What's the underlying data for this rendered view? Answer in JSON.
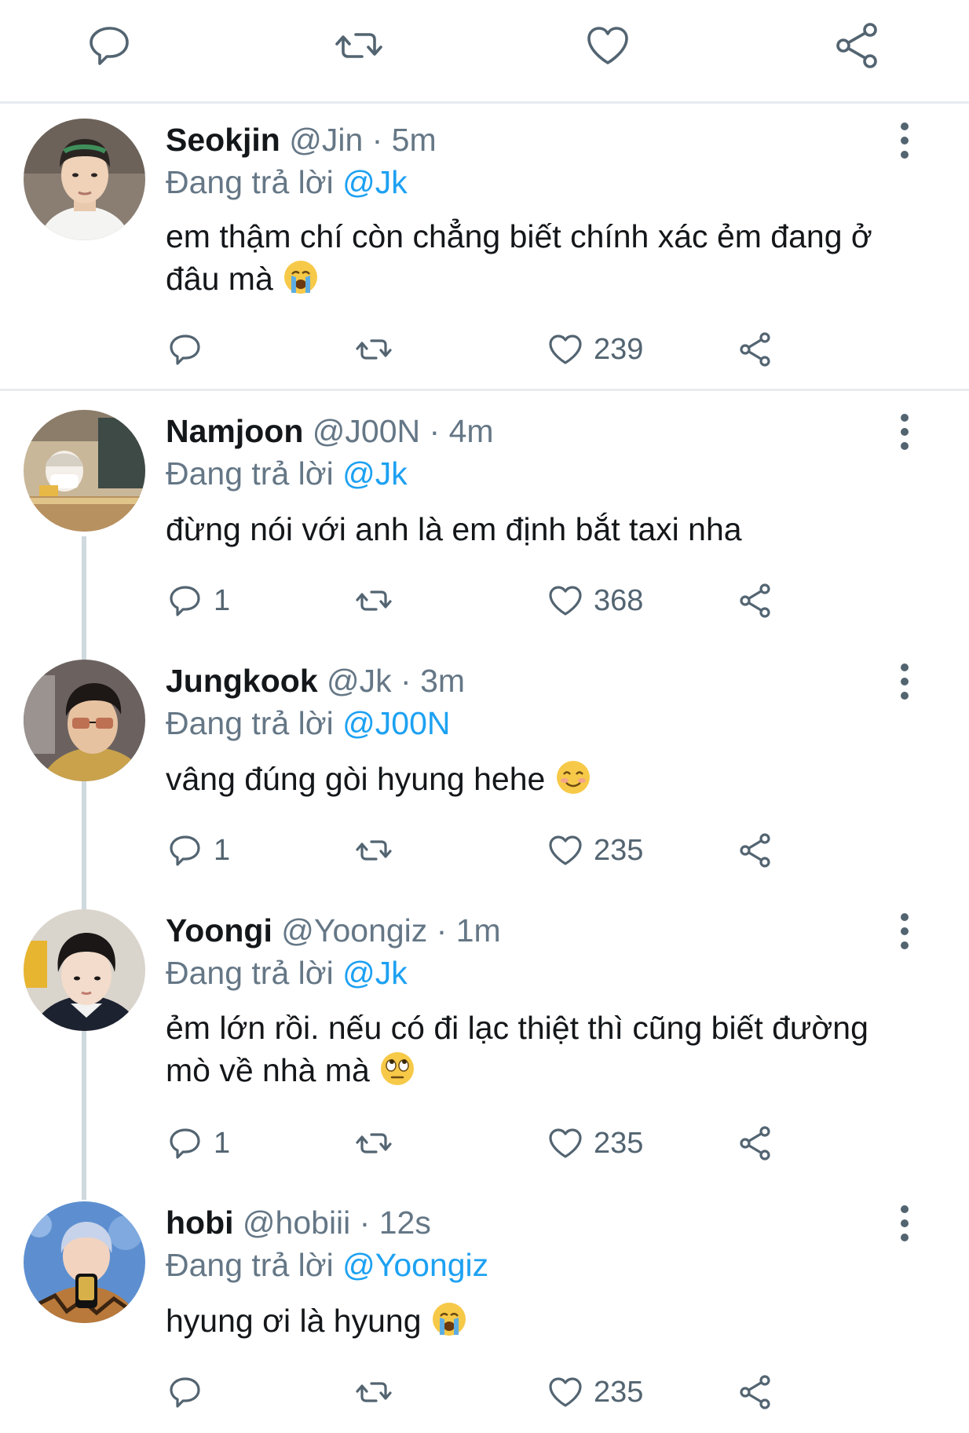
{
  "tweets": [
    {
      "name": "Seokjin",
      "handle_time": " @Jin · 5m",
      "reply_prefix": "Đang trả lời ",
      "reply_to": "@Jk",
      "text": "em thậm chí còn chẳng biết chính xác ẻm đang ở đâu mà",
      "emoji": "loudly-crying-face",
      "replies": "",
      "likes": "239"
    },
    {
      "name": "Namjoon",
      "handle_time": " @J00N · 4m",
      "reply_prefix": "Đang trả lời ",
      "reply_to": "@Jk",
      "text": "đừng nói với anh là em định bắt taxi nha",
      "emoji": "",
      "replies": "1",
      "likes": "368"
    },
    {
      "name": "Jungkook",
      "handle_time": "  @Jk · 3m",
      "reply_prefix": "Đang trả lời ",
      "reply_to": "@J00N",
      "text": "vâng đúng gòi hyung hehe",
      "emoji": "smiling-face-with-smiling-eyes",
      "replies": "1",
      "likes": "235"
    },
    {
      "name": "Yoongi",
      "handle_time": " @Yoongiz · 1m",
      "reply_prefix": "Đang trả lời ",
      "reply_to": "@Jk",
      "text": "ẻm lớn rồi. nếu có đi lạc thiệt thì cũng biết đường mò về nhà mà",
      "emoji": "face-with-rolling-eyes",
      "replies": "1",
      "likes": "235"
    },
    {
      "name": "hobi",
      "handle_time": "  @hobiii · 12s",
      "reply_prefix": "Đang trả lời ",
      "reply_to": "@Yoongiz",
      "text": "hyung ơi là hyung",
      "emoji": "loudly-crying-face",
      "replies": "",
      "likes": "235"
    }
  ],
  "icons": {
    "reply": "reply-icon",
    "retweet": "retweet-icon",
    "like": "heart-icon",
    "share": "share-icon",
    "more": "more-vertical-icon"
  },
  "colors": {
    "mention": "#1da1f2",
    "meta": "#657786",
    "icon": "#536471",
    "divider": "#e6ecf0"
  }
}
